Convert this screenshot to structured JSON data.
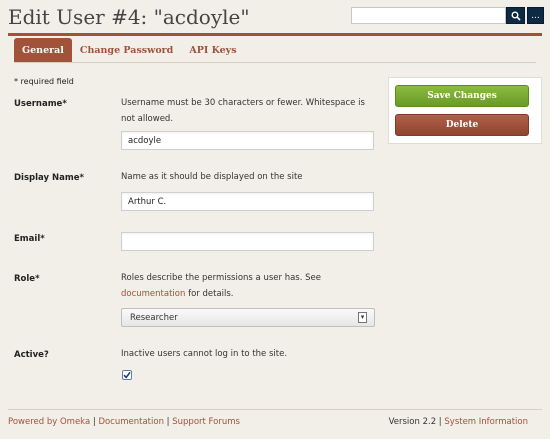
{
  "header": {
    "title": "Edit User #4: \"acdoyle\"",
    "search": {
      "value": "",
      "placeholder": ""
    },
    "search_button_icon": "search-icon",
    "advanced_search_label": "..."
  },
  "tabs": [
    {
      "label": "General",
      "active": true
    },
    {
      "label": "Change Password",
      "active": false
    },
    {
      "label": "API Keys",
      "active": false
    }
  ],
  "form": {
    "required_note": "* required field",
    "username": {
      "label": "Username*",
      "description": "Username must be 30 characters or fewer. Whitespace is not allowed.",
      "value": "acdoyle"
    },
    "display_name": {
      "label": "Display Name*",
      "description": "Name as it should be displayed on the site",
      "value": "Arthur C."
    },
    "email": {
      "label": "Email*",
      "value": ""
    },
    "role": {
      "label": "Role*",
      "description_before": "Roles describe the permissions a user has. See ",
      "description_link": "documentation",
      "description_after": " for details.",
      "selected": "Researcher"
    },
    "active": {
      "label": "Active?",
      "description": "Inactive users cannot log in to the site.",
      "checked": true
    }
  },
  "actions": {
    "save_label": "Save Changes",
    "delete_label": "Delete"
  },
  "footer": {
    "powered_by": "Powered by Omeka",
    "documentation": "Documentation",
    "support": "Support Forums",
    "separator": " | ",
    "version": "Version 2.2",
    "system_info": "System Information"
  },
  "colors": {
    "accent": "#a0523a",
    "search_button": "#0c2a44",
    "save_button": "#7aab32",
    "delete_button": "#9e5039",
    "background": "#f1efe8"
  }
}
